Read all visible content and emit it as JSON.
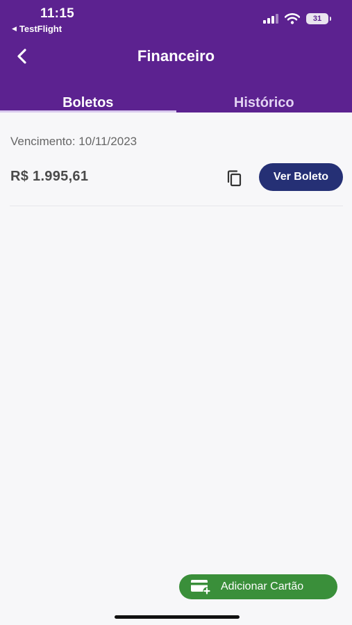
{
  "status_bar": {
    "time": "11:15",
    "back_app_label": "TestFlight",
    "battery_level": "31"
  },
  "header": {
    "title": "Financeiro"
  },
  "tabs": [
    {
      "label": "Boletos",
      "active": true
    },
    {
      "label": "Histórico",
      "active": false
    }
  ],
  "boleto": {
    "due_label": "Vencimento: 10/11/2023",
    "amount": "R$ 1.995,61",
    "view_button_label": "Ver Boleto"
  },
  "fab": {
    "label": "Adicionar Cartão"
  },
  "colors": {
    "header_purple": "#5c2290",
    "view_button_navy": "#253075",
    "add_card_green": "#3a8f3a",
    "background": "#f7f7f9"
  },
  "icons": {
    "back": "chevron-left-icon",
    "copy": "copy-icon",
    "add_card": "add-card-icon",
    "signal": "signal-icon",
    "wifi": "wifi-icon",
    "battery": "battery-icon"
  }
}
